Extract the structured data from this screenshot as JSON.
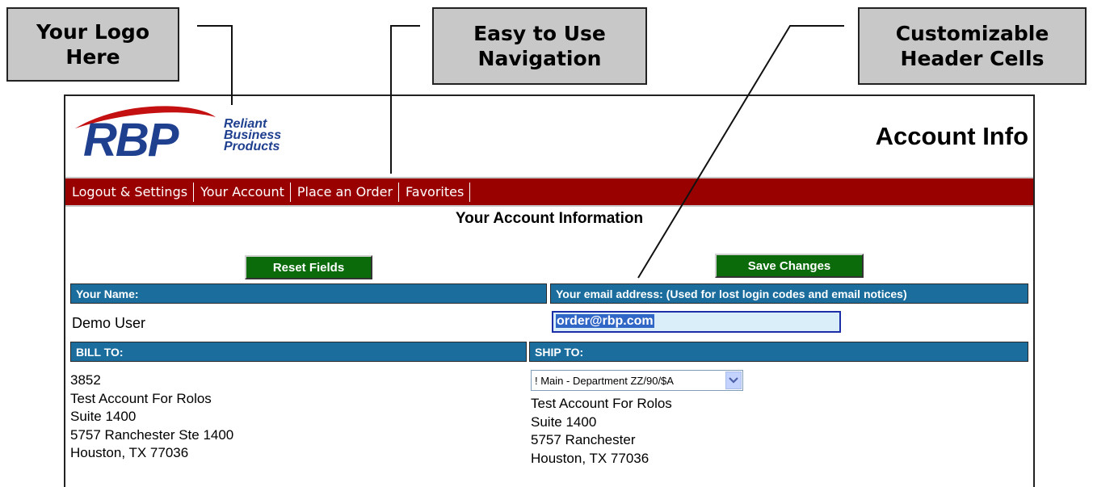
{
  "callouts": {
    "logo": "Your Logo\nHere",
    "navigation": "Easy to Use\nNavigation",
    "header_cells": "Customizable\nHeader Cells"
  },
  "brand": {
    "initials": "RBP",
    "name_lines": [
      "Reliant",
      "Business",
      "Products"
    ],
    "colors": {
      "blue": "#1f3f8f",
      "red": "#c41010"
    }
  },
  "page_heading": "Account Info",
  "nav": {
    "items": [
      "Logout & Settings",
      "Your Account",
      "Place an Order",
      "Favorites"
    ],
    "bar_color": "#990000"
  },
  "section_title": "Your Account Information",
  "buttons": {
    "reset": "Reset Fields",
    "save": "Save Changes",
    "color": "#0b6b0b"
  },
  "name_section": {
    "header": "Your Name:",
    "value": "Demo User"
  },
  "email_section": {
    "header": "Your email address: (Used for lost login codes and email notices)",
    "value": "order@rbp.com"
  },
  "bill_to": {
    "header": "BILL TO:",
    "lines": [
      "3852",
      "Test Account For Rolos",
      "Suite 1400",
      "5757 Ranchester Ste 1400",
      "Houston, TX  77036"
    ]
  },
  "ship_to": {
    "header": "SHIP TO:",
    "selected": "! Main - Department ZZ/90/$A",
    "lines": [
      "Test Account For Rolos",
      "Suite 1400",
      "5757 Ranchester",
      "Houston, TX  77036"
    ]
  },
  "header_cell_color": "#1a6d9c"
}
